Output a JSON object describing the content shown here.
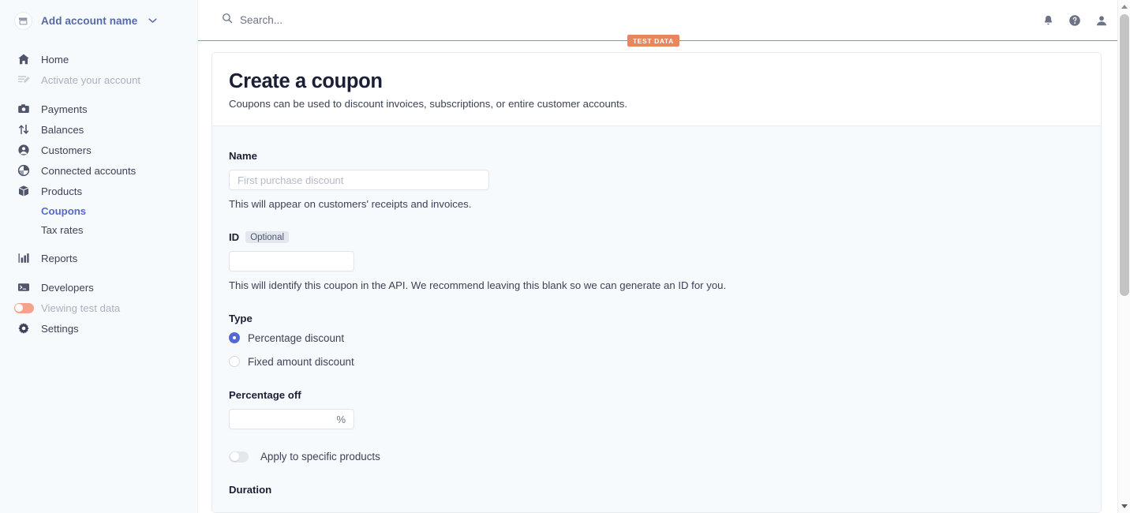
{
  "sidebar": {
    "account": {
      "logo_icon": "store-icon",
      "label": "Add account name",
      "chevron_icon": "chevron-down-icon"
    },
    "groups": [
      {
        "items": [
          {
            "label": "Home",
            "icon": "home-icon",
            "state": "normal"
          },
          {
            "label": "Activate your account",
            "icon": "activate-icon",
            "state": "muted"
          }
        ]
      },
      {
        "items": [
          {
            "label": "Payments",
            "icon": "payments-icon",
            "state": "normal"
          },
          {
            "label": "Balances",
            "icon": "balances-icon",
            "state": "normal"
          },
          {
            "label": "Customers",
            "icon": "customers-icon",
            "state": "normal"
          },
          {
            "label": "Connected accounts",
            "icon": "connected-accounts-icon",
            "state": "normal"
          },
          {
            "label": "Products",
            "icon": "products-icon",
            "state": "normal"
          }
        ],
        "subitems": [
          {
            "label": "Coupons",
            "state": "active"
          },
          {
            "label": "Tax rates",
            "state": "normal"
          }
        ]
      },
      {
        "items": [
          {
            "label": "Reports",
            "icon": "reports-icon",
            "state": "normal"
          }
        ]
      },
      {
        "items": [
          {
            "label": "Developers",
            "icon": "developers-icon",
            "state": "normal"
          },
          {
            "label": "Viewing test data",
            "icon": "toggle-on-icon",
            "state": "muted"
          },
          {
            "label": "Settings",
            "icon": "gear-icon",
            "state": "normal"
          }
        ]
      }
    ]
  },
  "topbar": {
    "search": {
      "icon": "search-icon",
      "placeholder": "Search..."
    },
    "icons": [
      {
        "name": "notifications-bell-icon"
      },
      {
        "name": "help-circle-icon"
      },
      {
        "name": "user-account-icon"
      }
    ]
  },
  "test_banner": {
    "badge_label": "TEST DATA",
    "line_color": "#e07b54",
    "badge_color": "#e8875e"
  },
  "page": {
    "title": "Create a coupon",
    "subtitle": "Coupons can be used to discount invoices, subscriptions, or entire customer accounts."
  },
  "form": {
    "name_field": {
      "label": "Name",
      "value": "",
      "placeholder": "First purchase discount",
      "help": "This will appear on customers' receipts and invoices."
    },
    "id_field": {
      "label": "ID",
      "optional_badge": "Optional",
      "value": "",
      "placeholder": "",
      "help": "This will identify this coupon in the API. We recommend leaving this blank so we can generate an ID for you."
    },
    "type_field": {
      "label": "Type",
      "options": [
        {
          "label": "Percentage discount",
          "selected": true
        },
        {
          "label": "Fixed amount discount",
          "selected": false
        }
      ]
    },
    "percentage_field": {
      "label": "Percentage off",
      "value": "",
      "suffix": "%"
    },
    "apply_products_toggle": {
      "label": "Apply to specific products",
      "on": false
    },
    "duration_field": {
      "label": "Duration"
    }
  },
  "scrollbar": {
    "up_arrow_icon": "triangle-up-icon",
    "down_arrow_icon": "triangle-down-icon"
  },
  "colors": {
    "accent": "#5469d4",
    "sidebar_bg": "#f7fafc",
    "test_orange": "#e8875e",
    "text_primary": "#1a1f36",
    "text_secondary": "#3c4257"
  }
}
